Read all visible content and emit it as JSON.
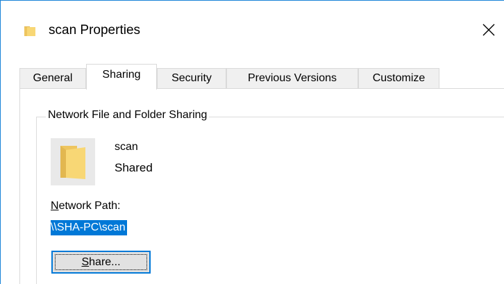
{
  "window": {
    "title": "scan Properties",
    "close_glyph": "✕"
  },
  "tabs": [
    {
      "label": "General",
      "active": false
    },
    {
      "label": "Sharing",
      "active": true
    },
    {
      "label": "Security",
      "active": false
    },
    {
      "label": "Previous Versions",
      "active": false
    },
    {
      "label": "Customize",
      "active": false
    }
  ],
  "sharing": {
    "group_title": "Network File and Folder Sharing",
    "share_name": "scan",
    "share_status": "Shared",
    "network_path_label_accel": "N",
    "network_path_label_rest": "etwork Path:",
    "network_path_value": "\\\\SHA-PC\\scan",
    "share_button_accel": "S",
    "share_button_rest": "hare..."
  },
  "icons": {
    "title_icon": "folder-icon",
    "share_icon": "folder-icon",
    "close": "close-icon"
  },
  "colors": {
    "accent": "#0078d7",
    "window_border": "#1883d7",
    "folder_yellow": "#f8d775"
  }
}
